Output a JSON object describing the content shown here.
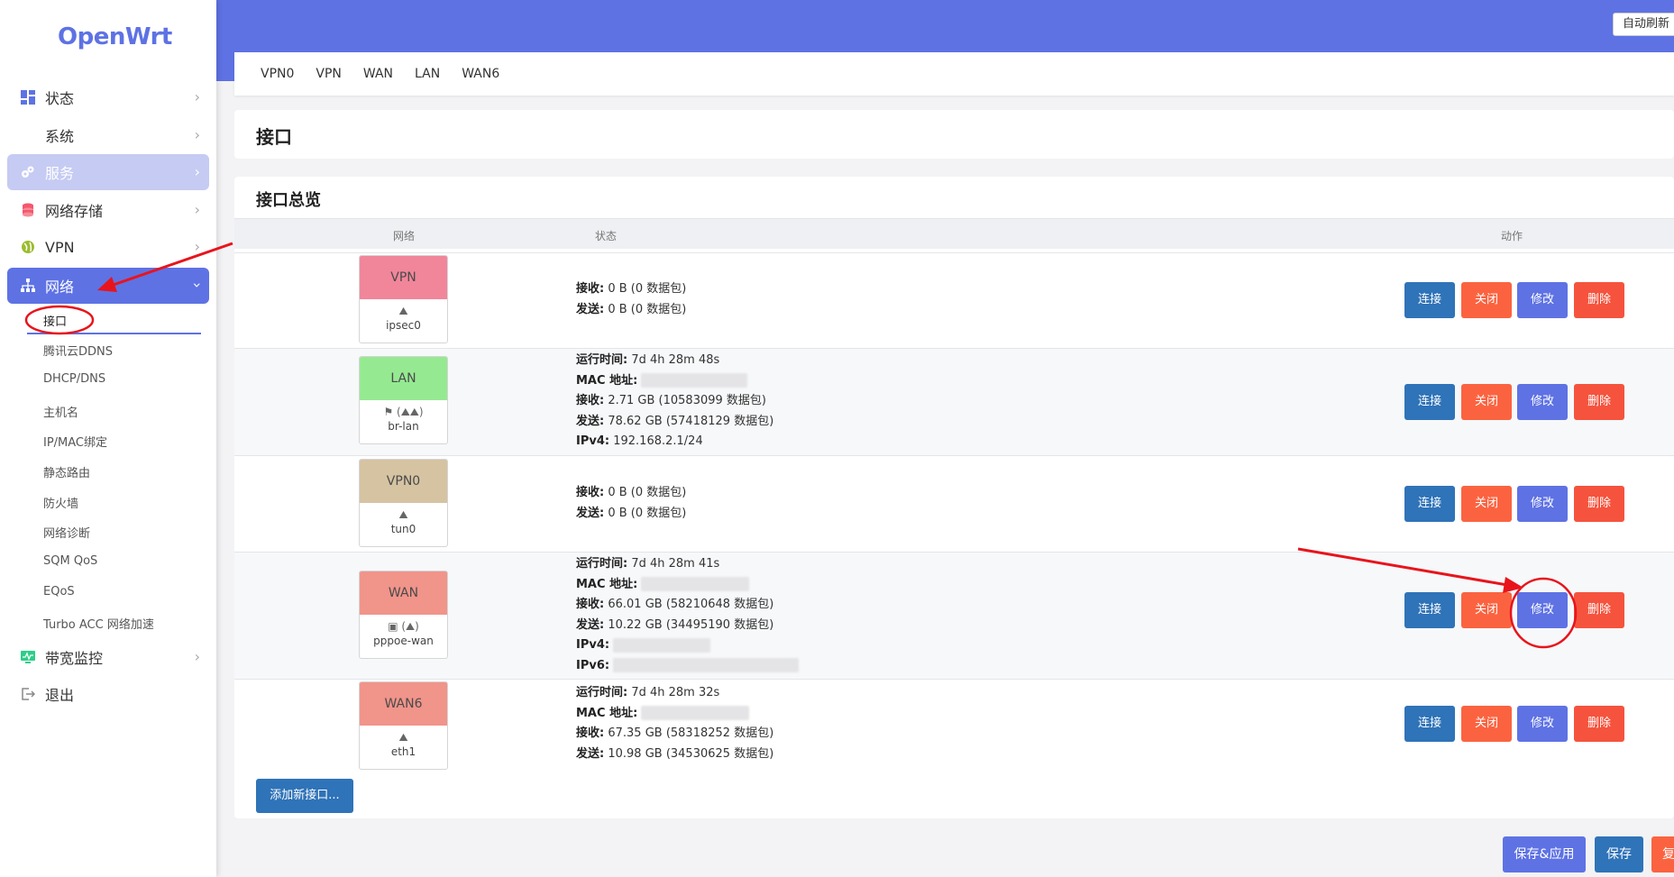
{
  "brand": {
    "logo": "OpenWrt"
  },
  "sidebar": {
    "items": [
      {
        "label": "状态",
        "icon": "dashboard-icon"
      },
      {
        "label": "系统"
      },
      {
        "label": "服务",
        "icon": "cogs-icon"
      },
      {
        "label": "网络存储",
        "icon": "database-icon"
      },
      {
        "label": "VPN",
        "icon": "globe-icon"
      },
      {
        "label": "网络",
        "icon": "sitemap-icon"
      },
      {
        "label": "带宽监控",
        "icon": "monitor-icon"
      },
      {
        "label": "退出",
        "icon": "logout-icon"
      }
    ],
    "network_submenu": [
      "接口",
      "腾讯云DDNS",
      "DHCP/DNS",
      "主机名",
      "IP/MAC绑定",
      "静态路由",
      "防火墙",
      "网络诊断",
      "SQM QoS",
      "EQoS",
      "Turbo ACC 网络加速"
    ]
  },
  "header": {
    "auto_refresh": "自动刷新"
  },
  "tabs": [
    "VPN0",
    "VPN",
    "WAN",
    "LAN",
    "WAN6"
  ],
  "page": {
    "title": "接口",
    "section_title": "接口总览"
  },
  "table": {
    "headers": {
      "network": "网络",
      "status": "状态",
      "actions": "动作"
    },
    "actions": {
      "connect": "连接",
      "close": "关闭",
      "edit": "修改",
      "delete": "删除"
    },
    "rows": [
      {
        "name": "VPN",
        "device": "ipsec0",
        "color": "#f1869b",
        "icon_glyph": "⛰",
        "status": [
          {
            "k": "接收:",
            "v": "0 B (0 数据包)"
          },
          {
            "k": "发送:",
            "v": "0 B (0 数据包)"
          }
        ]
      },
      {
        "name": "LAN",
        "device": "br-lan",
        "color": "#95ea91",
        "icon_glyph": "⚑ (⛰⛰)",
        "status": [
          {
            "k": "运行时间:",
            "v": "7d 4h 28m 48s"
          },
          {
            "k": "MAC 地址:",
            "v": ""
          },
          {
            "k": "接收:",
            "v": "2.71 GB (10583099 数据包)"
          },
          {
            "k": "发送:",
            "v": "78.62 GB (57418129 数据包)"
          },
          {
            "k": "IPv4:",
            "v": "192.168.2.1/24"
          }
        ]
      },
      {
        "name": "VPN0",
        "device": "tun0",
        "color": "#d6c3a2",
        "icon_glyph": "⛰",
        "status": [
          {
            "k": "接收:",
            "v": "0 B (0 数据包)"
          },
          {
            "k": "发送:",
            "v": "0 B (0 数据包)"
          }
        ]
      },
      {
        "name": "WAN",
        "device": "pppoe-wan",
        "color": "#f1948a",
        "icon_glyph": "▣ (⛰)",
        "status": [
          {
            "k": "运行时间:",
            "v": "7d 4h 28m 41s"
          },
          {
            "k": "MAC 地址:",
            "v": ""
          },
          {
            "k": "接收:",
            "v": "66.01 GB (58210648 数据包)"
          },
          {
            "k": "发送:",
            "v": "10.22 GB (34495190 数据包)"
          },
          {
            "k": "IPv4:",
            "v": ""
          },
          {
            "k": "IPv6:",
            "v": ""
          }
        ]
      },
      {
        "name": "WAN6",
        "device": "eth1",
        "color": "#f1948a",
        "icon_glyph": "⛰",
        "status": [
          {
            "k": "运行时间:",
            "v": "7d 4h 28m 32s"
          },
          {
            "k": "MAC 地址:",
            "v": ""
          },
          {
            "k": "接收:",
            "v": "67.35 GB (58318252 数据包)"
          },
          {
            "k": "发送:",
            "v": "10.98 GB (34530625 数据包)"
          }
        ]
      }
    ]
  },
  "add_button": "添加新接口...",
  "footer": {
    "save_apply": "保存&应用",
    "save": "保存",
    "reset": "复位"
  }
}
